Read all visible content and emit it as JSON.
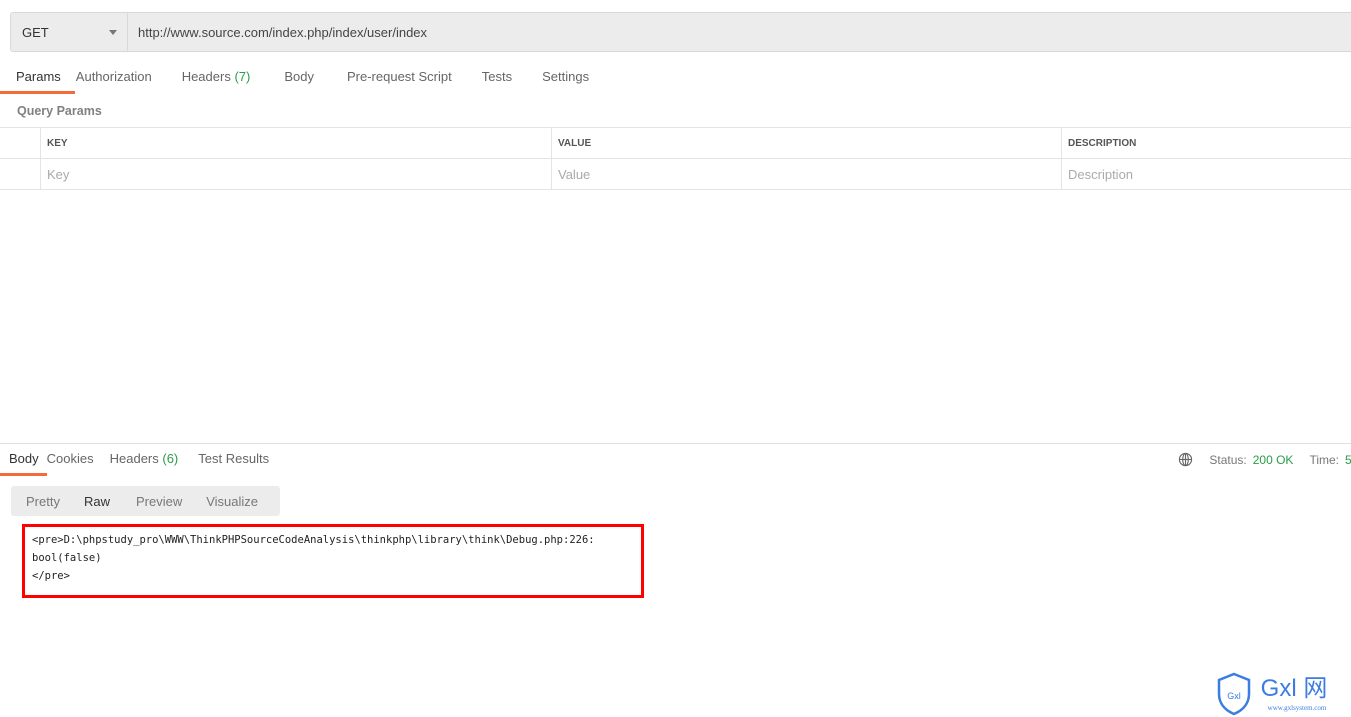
{
  "request": {
    "method": "GET",
    "url": "http://www.source.com/index.php/index/user/index"
  },
  "request_tabs": [
    {
      "label": "Params",
      "count": ""
    },
    {
      "label": "Authorization",
      "count": ""
    },
    {
      "label": "Headers",
      "count": "(7)"
    },
    {
      "label": "Body",
      "count": ""
    },
    {
      "label": "Pre-request Script",
      "count": ""
    },
    {
      "label": "Tests",
      "count": ""
    },
    {
      "label": "Settings",
      "count": ""
    }
  ],
  "query_params": {
    "title": "Query Params",
    "headers": {
      "key": "KEY",
      "value": "VALUE",
      "description": "DESCRIPTION"
    },
    "placeholders": {
      "key": "Key",
      "value": "Value",
      "description": "Description"
    }
  },
  "response_tabs": [
    {
      "label": "Body",
      "count": ""
    },
    {
      "label": "Cookies",
      "count": ""
    },
    {
      "label": "Headers",
      "count": "(6)"
    },
    {
      "label": "Test Results",
      "count": ""
    }
  ],
  "status": {
    "status_label": "Status:",
    "status_value": "200 OK",
    "time_label": "Time:",
    "time_value": "5"
  },
  "view_tabs": [
    "Pretty",
    "Raw",
    "Preview",
    "Visualize"
  ],
  "response_body": "<pre>D:\\phpstudy_pro\\WWW\\ThinkPHPSourceCodeAnalysis\\thinkphp\\library\\think\\Debug.php:226:\nbool(false)\n</pre>",
  "watermark": {
    "text": "Gxl 网",
    "site": "www.gxlsystem.com",
    "shield_text": "Gxl"
  },
  "colors": {
    "accent": "#f26b3a",
    "success": "#2a9d48",
    "highlight": "#ff0000"
  }
}
